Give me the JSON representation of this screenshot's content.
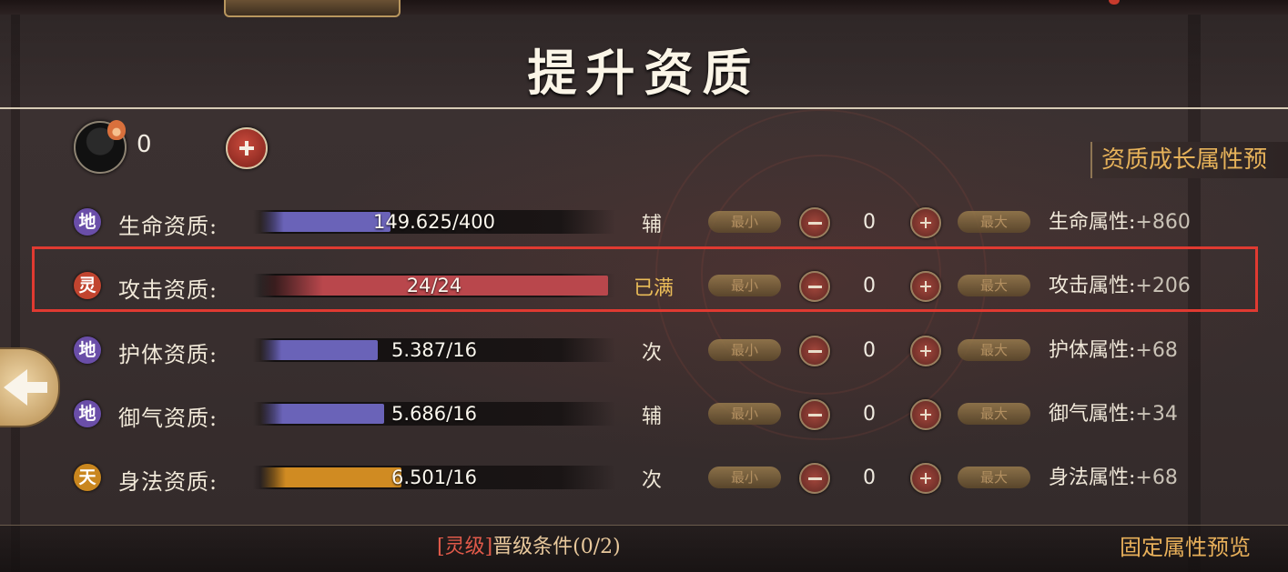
{
  "title": "提升资质",
  "resource": {
    "count": "0"
  },
  "preview_growth_label": "资质成长属性预",
  "rows": [
    {
      "grade": "地",
      "grade_color": "#6a4ea8",
      "label": "生命资质:",
      "value": "149.625/400",
      "progress": 0.374,
      "bar_color": "#6a63b8",
      "status": "辅",
      "min_label": "最小",
      "allocated": "0",
      "max_label": "最大",
      "attr_label": "生命属性:",
      "attr_value": "+860"
    },
    {
      "grade": "灵",
      "grade_color": "#c1442f",
      "label": "攻击资质:",
      "value": "24/24",
      "progress": 1.0,
      "bar_color": "#b9474c",
      "status": "已满",
      "min_label": "最小",
      "allocated": "0",
      "max_label": "最大",
      "attr_label": "攻击属性:",
      "attr_value": "+206"
    },
    {
      "grade": "地",
      "grade_color": "#6a4ea8",
      "label": "护体资质:",
      "value": "5.387/16",
      "progress": 0.337,
      "bar_color": "#6a63b8",
      "status": "次",
      "min_label": "最小",
      "allocated": "0",
      "max_label": "最大",
      "attr_label": "护体属性:",
      "attr_value": "+68"
    },
    {
      "grade": "地",
      "grade_color": "#6a4ea8",
      "label": "御气资质:",
      "value": "5.686/16",
      "progress": 0.355,
      "bar_color": "#6a63b8",
      "status": "辅",
      "min_label": "最小",
      "allocated": "0",
      "max_label": "最大",
      "attr_label": "御气属性:",
      "attr_value": "+34"
    },
    {
      "grade": "天",
      "grade_color": "#c9861e",
      "label": "身法资质:",
      "value": "6.501/16",
      "progress": 0.406,
      "bar_color": "#d08b22",
      "status": "次",
      "min_label": "最小",
      "allocated": "0",
      "max_label": "最大",
      "attr_label": "身法属性:",
      "attr_value": "+68"
    }
  ],
  "upgrade": {
    "tag": "[灵级]",
    "text": "晋级条件(0/2)"
  },
  "preview_fixed_label": "固定属性预览"
}
